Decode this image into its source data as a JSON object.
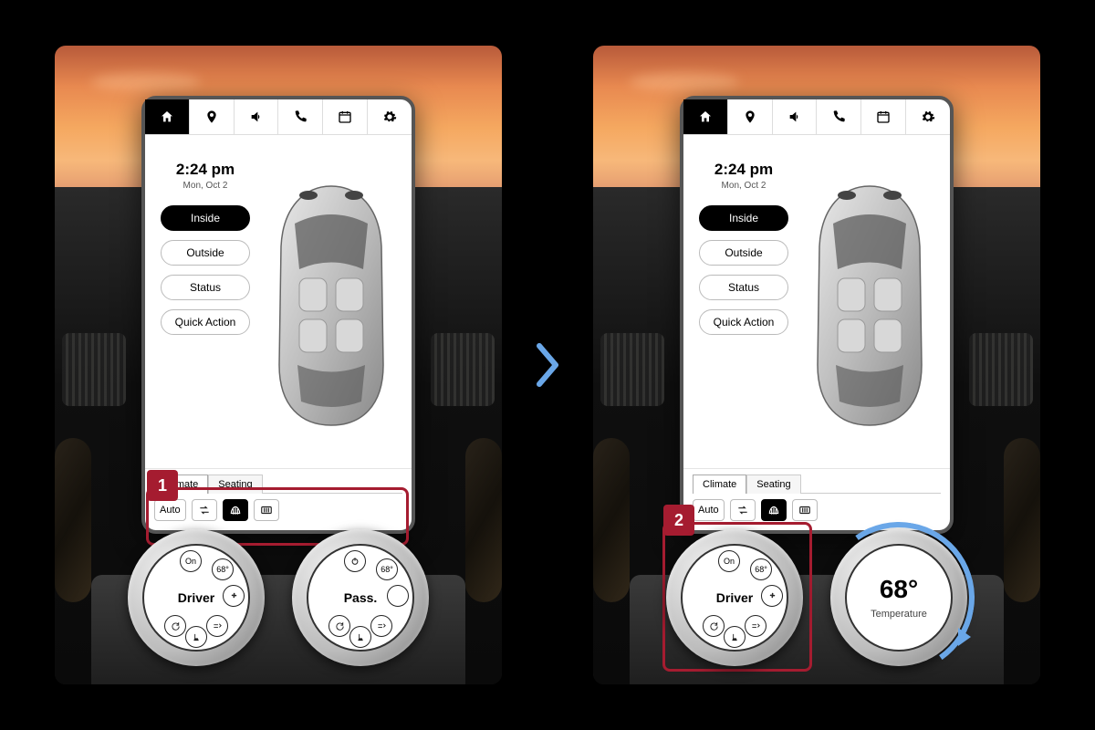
{
  "nav": {
    "items": [
      "home",
      "location",
      "volume",
      "phone",
      "calendar",
      "settings"
    ],
    "active": 0
  },
  "clock": {
    "time": "2:24 pm",
    "date": "Mon, Oct 2"
  },
  "view_pills": [
    {
      "label": "Inside",
      "active": true
    },
    {
      "label": "Outside",
      "active": false
    },
    {
      "label": "Status",
      "active": false
    },
    {
      "label": "Quick Action",
      "active": false
    }
  ],
  "bottom_tabs": [
    {
      "label": "Climate",
      "active": true
    },
    {
      "label": "Seating",
      "active": false
    }
  ],
  "climate_controls": {
    "auto_label": "Auto",
    "auto_active": false,
    "recirc_active": false,
    "front_defrost_active": true,
    "rear_defrost_active": false
  },
  "dials": {
    "driver": {
      "label": "Driver",
      "on_label": "On",
      "temp": "68°"
    },
    "passenger": {
      "label": "Pass.",
      "on_label": "",
      "temp": "68°"
    },
    "expanded": {
      "value": "68°",
      "label": "Temperature"
    }
  },
  "callouts": {
    "step1": "1",
    "step2": "2"
  },
  "colors": {
    "accent_red": "#a51c30",
    "accent_blue": "#6aa7e8"
  }
}
